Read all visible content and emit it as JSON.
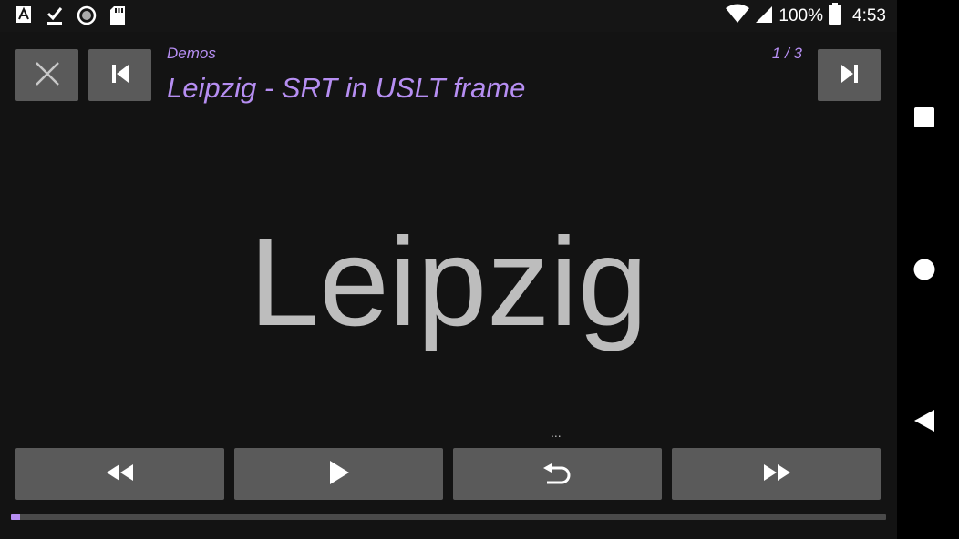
{
  "status_bar": {
    "battery_percent": "100%",
    "time": "4:53",
    "icons": [
      "font-a-icon",
      "download-done-icon",
      "radio-circle-icon",
      "sd-card-icon",
      "wifi-icon",
      "cell-signal-icon",
      "battery-icon"
    ]
  },
  "player": {
    "album": "Demos",
    "title": "Leipzig - SRT in USLT frame",
    "track_position": "1 / 3",
    "lyric": "Leipzig",
    "more_indicator": "...",
    "progress_fraction": 0.01
  },
  "controls": {
    "top": [
      "close-icon",
      "skip-previous-icon",
      "skip-next-icon"
    ],
    "bottom": [
      "rewind-icon",
      "play-icon",
      "replay-icon",
      "fast-forward-icon"
    ]
  },
  "navigation": [
    "recents-square-icon",
    "home-circle-icon",
    "back-triangle-icon"
  ],
  "colors": {
    "accent": "#b68ef2",
    "button": "#5a5a5a",
    "background": "#131313",
    "lyric_text": "#bdbdbd"
  }
}
